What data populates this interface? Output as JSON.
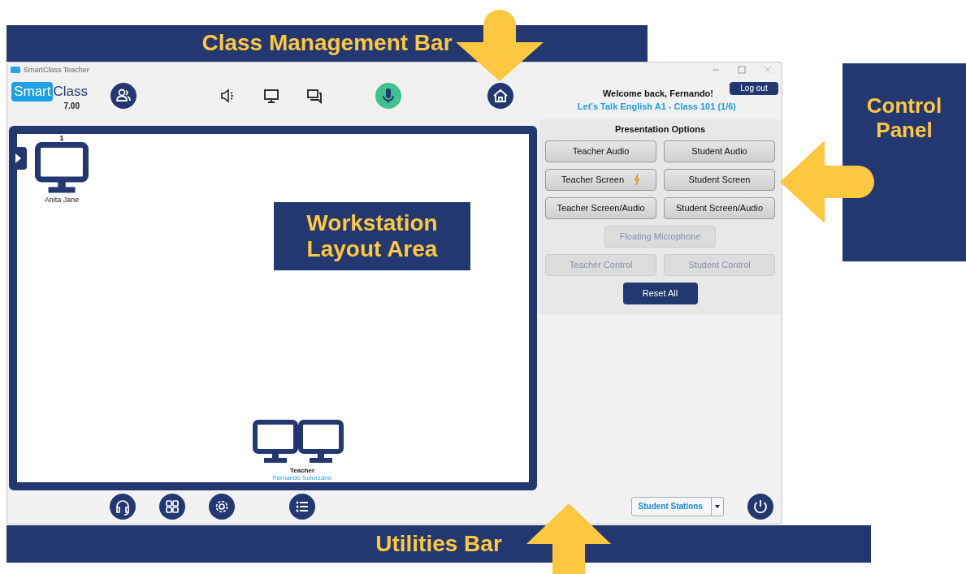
{
  "window": {
    "title": "SmartClass Teacher"
  },
  "logo": {
    "brand_a": "Smart",
    "brand_b": "Class",
    "version": "7.00"
  },
  "toolbar": [
    {
      "kind": "group"
    },
    {
      "kind": "speaker"
    },
    {
      "kind": "monitor"
    },
    {
      "kind": "chat"
    },
    {
      "kind": "mic"
    },
    {
      "kind": "home"
    }
  ],
  "welcome": {
    "greeting": "Welcome back, Fernando!",
    "class_name": "Let's Talk English A1 - Class 101 (1/6)",
    "logout": "Log out"
  },
  "workstations": [
    {
      "number": "1",
      "name": "Anita Jane"
    }
  ],
  "teacher_station": {
    "role": "Teacher",
    "name": "Fernando Solorzano"
  },
  "control_panel": {
    "title": "Presentation Options",
    "rows": [
      [
        {
          "label": "Teacher Audio",
          "disabled": false,
          "flash": false
        },
        {
          "label": "Student Audio",
          "disabled": false,
          "flash": false
        }
      ],
      [
        {
          "label": "Teacher Screen",
          "disabled": false,
          "flash": true
        },
        {
          "label": "Student Screen",
          "disabled": false,
          "flash": false
        }
      ],
      [
        {
          "label": "Teacher Screen/Audio",
          "disabled": false,
          "flash": false
        },
        {
          "label": "Student Screen/Audio",
          "disabled": false,
          "flash": false
        }
      ],
      [
        {
          "label": "Floating Microphone",
          "disabled": true,
          "flash": false
        }
      ],
      [
        {
          "label": "Teacher Control",
          "disabled": true,
          "flash": false
        },
        {
          "label": "Student Control",
          "disabled": true,
          "flash": false
        }
      ]
    ],
    "reset": "Reset All"
  },
  "utilities": [
    {
      "kind": "headset"
    },
    {
      "kind": "grid"
    },
    {
      "kind": "gear"
    },
    {
      "kind": "list"
    }
  ],
  "station_select": {
    "value": "Student Stations"
  },
  "annotations": [
    {
      "text": "Class Management Bar",
      "kind": "down"
    },
    {
      "text": "Control Panel",
      "kind": "left"
    },
    {
      "text": "Workstation Layout Area",
      "kind": "plain"
    },
    {
      "text": "Utilities Bar",
      "kind": "up"
    }
  ]
}
